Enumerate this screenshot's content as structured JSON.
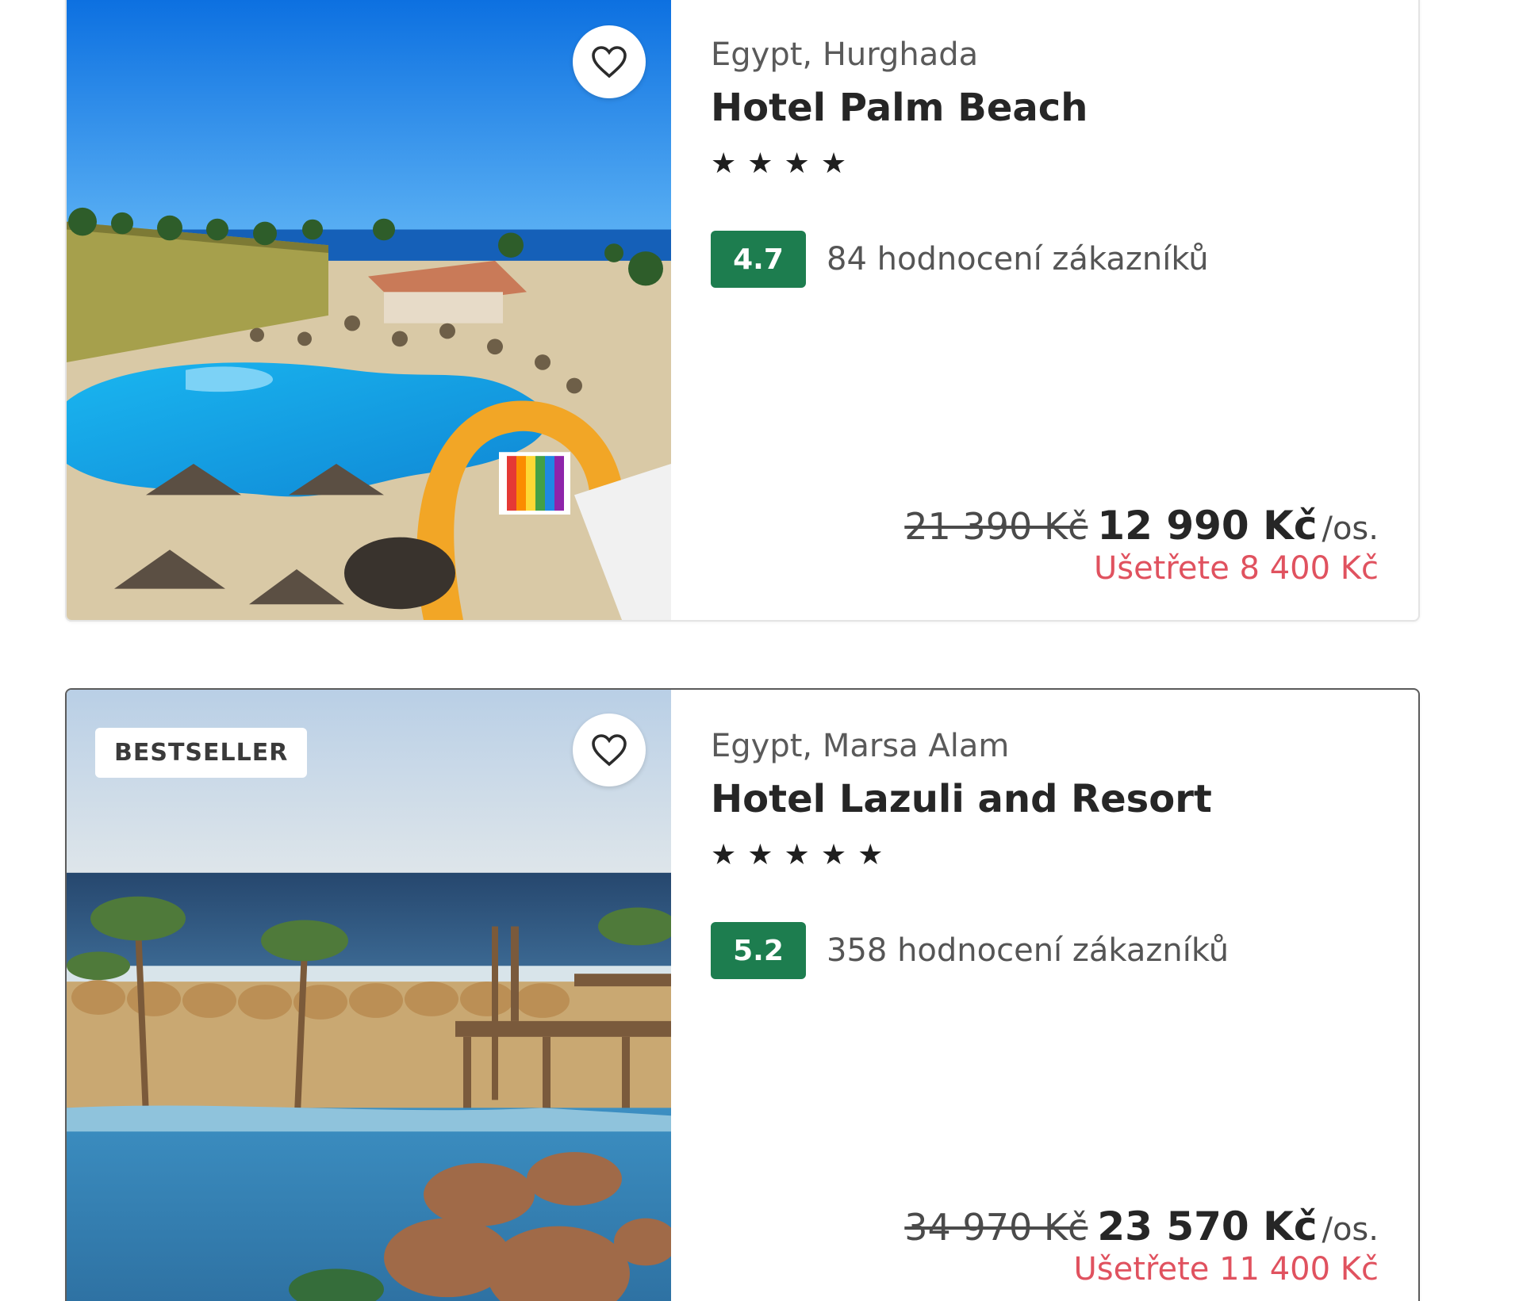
{
  "hotels": [
    {
      "location": "Egypt, Hurghada",
      "name": "Hotel Palm Beach",
      "stars": "★★★★",
      "star_count": 4,
      "score": "4.7",
      "reviews": "84 hodnocení zákazníků",
      "old_price": "21 390 Kč",
      "new_price": "12 990 Kč",
      "per_person": "/os.",
      "savings": "Ušetřete 8 400 Kč",
      "favorite_icon": "heart-outline-icon"
    },
    {
      "badge": "BESTSELLER",
      "location": "Egypt, Marsa Alam",
      "name": "Hotel Lazuli and Resort",
      "stars": "★★★★★",
      "star_count": 5,
      "score": "5.2",
      "reviews": "358 hodnocení zákazníků",
      "old_price": "34 970 Kč",
      "new_price": "23 570 Kč",
      "per_person": "/os.",
      "savings": "Ušetřete 11 400 Kč",
      "favorite_icon": "heart-outline-icon"
    }
  ],
  "colors": {
    "score_badge": "#1d7d4f",
    "savings_text": "#e0525f",
    "card_border": "#e4e4e4"
  }
}
